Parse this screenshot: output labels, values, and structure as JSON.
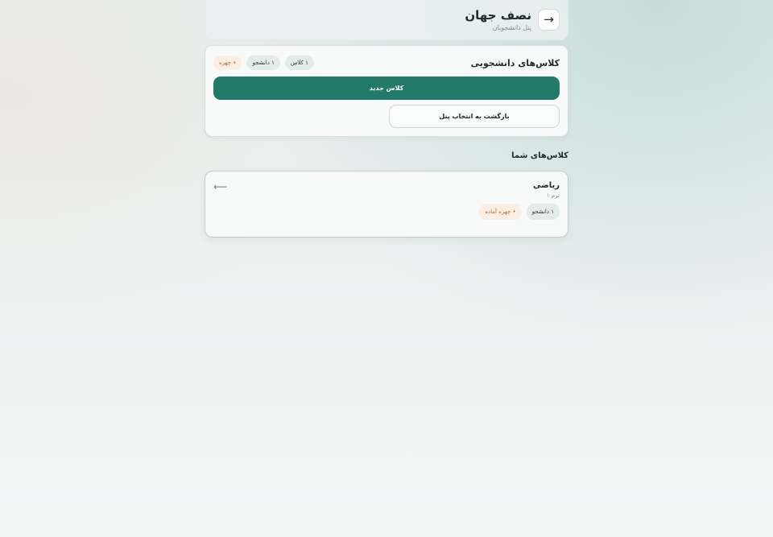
{
  "header": {
    "title": "نصف جهان",
    "subtitle": "پنل دانشجویان",
    "back_icon": "→"
  },
  "panel": {
    "title": "کلاس‌های دانشجویی",
    "badges": [
      "۱ کلاس",
      "۱ دانشجو",
      "• چهره"
    ],
    "new_class_label": "کلاس جدید",
    "back_to_panel_label": "بازگشت به انتخاب پنل"
  },
  "classes_section": {
    "title": "کلاس‌های شما",
    "items": [
      {
        "name": "ریاضی",
        "term": "ترم ۱",
        "students_badge": "۱ دانشجو",
        "face_badge": "• چهره آماده",
        "arrow": "⟵"
      }
    ]
  },
  "colors": {
    "accent": "#227a68",
    "warn_bg": "#fbeee2",
    "warn_text": "#b86a2a"
  }
}
